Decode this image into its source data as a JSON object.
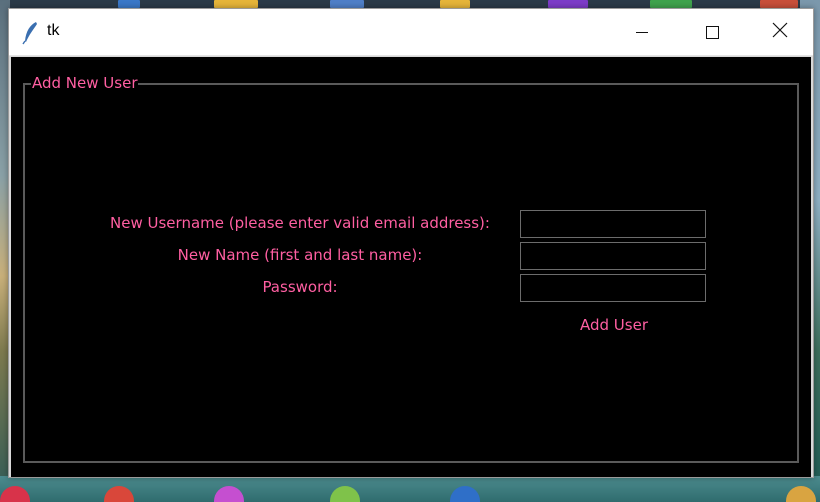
{
  "window": {
    "title": "tk",
    "controls": {
      "minimize_icon": "minimize-icon",
      "maximize_icon": "maximize-icon",
      "close_icon": "close-icon"
    }
  },
  "form": {
    "frame_title": "Add New User",
    "username_label": "New Username (please enter valid email address):",
    "name_label": "New Name (first and last name):",
    "password_label": "Password:",
    "username_value": "",
    "name_value": "",
    "password_value": "",
    "add_button_label": "Add User"
  },
  "colors": {
    "accent_text": "#ff5fa2",
    "background": "#000000",
    "field_border": "#6c6c6c"
  }
}
